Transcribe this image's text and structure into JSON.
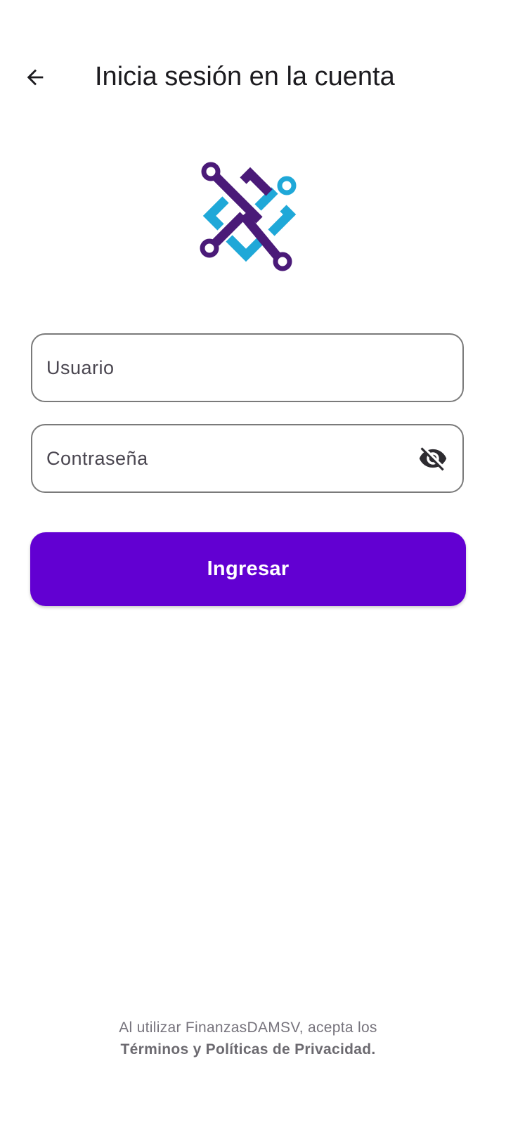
{
  "header": {
    "back_icon": "arrow-left-icon",
    "title": "Inicia sesión en la cuenta"
  },
  "logo": {
    "icon": "app-logo",
    "colors": {
      "primary": "#4a1a78",
      "secondary": "#1fa8d8"
    }
  },
  "form": {
    "username": {
      "placeholder": "Usuario",
      "value": ""
    },
    "password": {
      "placeholder": "Contraseña",
      "value": "",
      "toggle_icon": "eye-off-icon"
    },
    "submit_label": "Ingresar"
  },
  "footer": {
    "text": "Al utilizar FinanzasDAMSV, acepta los",
    "terms_link": "Términos y Políticas de Privacidad."
  },
  "theme": {
    "accent": "#6200d2",
    "field_border": "#7a7a7a",
    "text": "#1c1b1f"
  }
}
